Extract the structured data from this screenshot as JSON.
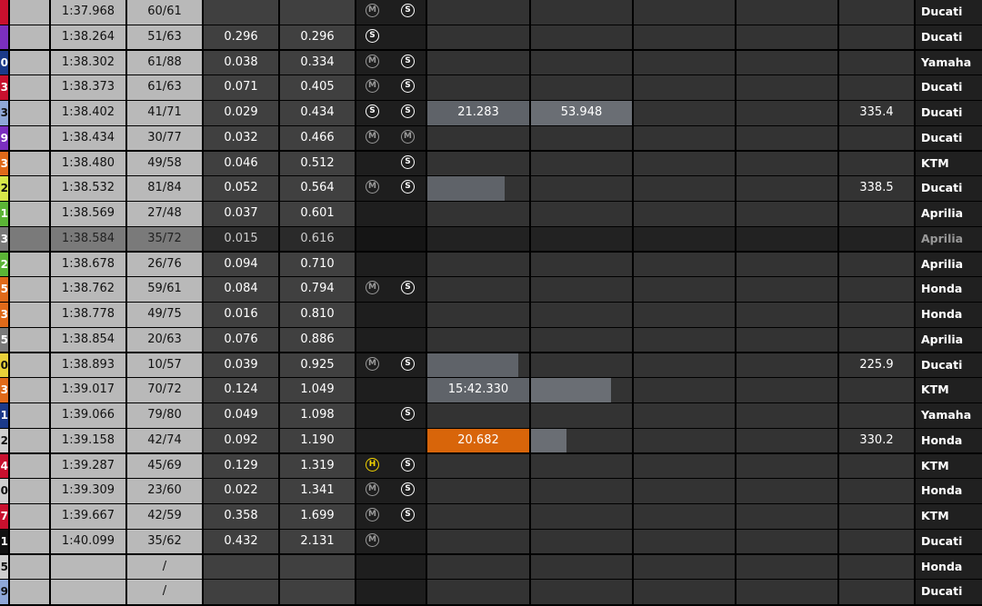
{
  "colors": {
    "sector_grey": "#5f6369",
    "sector_bar_grey": "#6a6e74",
    "sector_orange": "#d8650a",
    "soft": "#ffffff",
    "medium": "#9a9a9a",
    "hard": "#f2d400"
  },
  "tyre_letters": {
    "soft": "S",
    "medium": "M",
    "hard": "H"
  },
  "rows": [
    {
      "num": "",
      "num_color": "#c8102e",
      "best_lap": "1:37.968",
      "laps": "60/61",
      "gap": "",
      "to_leader": "",
      "tyres": [
        "medium",
        "soft"
      ],
      "s1": "",
      "s1_fill": 0,
      "s1_color": "",
      "s2": "",
      "s2_fill": 0,
      "speed": "",
      "manufacturer": "Ducati"
    },
    {
      "num": "",
      "num_color": "#7b2fbf",
      "best_lap": "1:38.264",
      "laps": "51/63",
      "gap": "0.296",
      "to_leader": "0.296",
      "tyres": [
        "soft"
      ],
      "s1": "",
      "s1_fill": 0,
      "s1_color": "",
      "s2": "",
      "s2_fill": 0,
      "speed": "",
      "manufacturer": "Ducati"
    },
    {
      "num": "0",
      "num_color": "#1b3a8a",
      "best_lap": "1:38.302",
      "laps": "61/88",
      "gap": "0.038",
      "to_leader": "0.334",
      "tyres": [
        "medium",
        "soft"
      ],
      "s1": "",
      "s1_fill": 0,
      "s1_color": "",
      "s2": "",
      "s2_fill": 0,
      "speed": "",
      "manufacturer": "Yamaha"
    },
    {
      "num": "3",
      "num_color": "#c8102e",
      "best_lap": "1:38.373",
      "laps": "61/63",
      "gap": "0.071",
      "to_leader": "0.405",
      "tyres": [
        "medium",
        "soft"
      ],
      "s1": "",
      "s1_fill": 0,
      "s1_color": "",
      "s2": "",
      "s2_fill": 0,
      "speed": "",
      "manufacturer": "Ducati"
    },
    {
      "num": "3",
      "num_color": "#8fa8d8",
      "best_lap": "1:38.402",
      "laps": "41/71",
      "gap": "0.029",
      "to_leader": "0.434",
      "tyres": [
        "soft",
        "soft"
      ],
      "s1": "21.283",
      "s1_fill": 1,
      "s1_color": "grey",
      "s2": "53.948",
      "s2_fill": 1,
      "speed": "335.4",
      "manufacturer": "Ducati"
    },
    {
      "num": "9",
      "num_color": "#7b2fbf",
      "best_lap": "1:38.434",
      "laps": "30/77",
      "gap": "0.032",
      "to_leader": "0.466",
      "tyres": [
        "medium",
        "medium"
      ],
      "s1": "",
      "s1_fill": 0,
      "s1_color": "",
      "s2": "",
      "s2_fill": 0,
      "speed": "",
      "manufacturer": "Ducati"
    },
    {
      "num": "3",
      "num_color": "#e06a1a",
      "best_lap": "1:38.480",
      "laps": "49/58",
      "gap": "0.046",
      "to_leader": "0.512",
      "tyres": [
        "",
        "soft"
      ],
      "s1": "",
      "s1_fill": 0,
      "s1_color": "",
      "s2": "",
      "s2_fill": 0,
      "speed": "",
      "manufacturer": "KTM"
    },
    {
      "num": "2",
      "num_color": "#d8e84a",
      "best_lap": "1:38.532",
      "laps": "81/84",
      "gap": "0.052",
      "to_leader": "0.564",
      "tyres": [
        "medium",
        "soft"
      ],
      "s1": "",
      "s1_fill": 0.76,
      "s1_color": "grey",
      "s2": "",
      "s2_fill": 0,
      "speed": "338.5",
      "manufacturer": "Ducati"
    },
    {
      "num": "1",
      "num_color": "#5bb536",
      "best_lap": "1:38.569",
      "laps": "27/48",
      "gap": "0.037",
      "to_leader": "0.601",
      "tyres": [],
      "s1": "",
      "s1_fill": 0,
      "s1_color": "",
      "s2": "",
      "s2_fill": 0,
      "speed": "",
      "manufacturer": "Aprilia"
    },
    {
      "num": "3",
      "num_color": "#7a7a7a",
      "best_lap": "1:38.584",
      "laps": "35/72",
      "gap": "0.015",
      "to_leader": "0.616",
      "tyres": [],
      "s1": "",
      "s1_fill": 0,
      "s1_color": "",
      "s2": "",
      "s2_fill": 0,
      "speed": "",
      "manufacturer": "Aprilia",
      "dim": true
    },
    {
      "num": "2",
      "num_color": "#5bb536",
      "best_lap": "1:38.678",
      "laps": "26/76",
      "gap": "0.094",
      "to_leader": "0.710",
      "tyres": [],
      "s1": "",
      "s1_fill": 0,
      "s1_color": "",
      "s2": "",
      "s2_fill": 0,
      "speed": "",
      "manufacturer": "Aprilia"
    },
    {
      "num": "5",
      "num_color": "#e06a1a",
      "best_lap": "1:38.762",
      "laps": "59/61",
      "gap": "0.084",
      "to_leader": "0.794",
      "tyres": [
        "medium",
        "soft"
      ],
      "s1": "",
      "s1_fill": 0,
      "s1_color": "",
      "s2": "",
      "s2_fill": 0,
      "speed": "",
      "manufacturer": "Honda"
    },
    {
      "num": "3",
      "num_color": "#e06a1a",
      "best_lap": "1:38.778",
      "laps": "49/75",
      "gap": "0.016",
      "to_leader": "0.810",
      "tyres": [],
      "s1": "",
      "s1_fill": 0,
      "s1_color": "",
      "s2": "",
      "s2_fill": 0,
      "speed": "",
      "manufacturer": "Honda"
    },
    {
      "num": "5",
      "num_color": "#7a7a7a",
      "best_lap": "1:38.854",
      "laps": "20/63",
      "gap": "0.076",
      "to_leader": "0.886",
      "tyres": [],
      "s1": "",
      "s1_fill": 0,
      "s1_color": "",
      "s2": "",
      "s2_fill": 0,
      "speed": "",
      "manufacturer": "Aprilia"
    },
    {
      "num": "0",
      "num_color": "#e8d13a",
      "best_lap": "1:38.893",
      "laps": "10/57",
      "gap": "0.039",
      "to_leader": "0.925",
      "tyres": [
        "medium",
        "soft"
      ],
      "s1": "",
      "s1_fill": 0.89,
      "s1_color": "grey",
      "s2": "",
      "s2_fill": 0,
      "speed": "225.9",
      "manufacturer": "Ducati"
    },
    {
      "num": "3",
      "num_color": "#e06a1a",
      "best_lap": "1:39.017",
      "laps": "70/72",
      "gap": "0.124",
      "to_leader": "1.049",
      "tyres": [],
      "s1": "15:42.330",
      "s1_fill": 1,
      "s1_color": "grey",
      "s2": "",
      "s2_fill": 0.79,
      "speed": "",
      "manufacturer": "KTM"
    },
    {
      "num": "1",
      "num_color": "#1b3a8a",
      "best_lap": "1:39.066",
      "laps": "79/80",
      "gap": "0.049",
      "to_leader": "1.098",
      "tyres": [
        "",
        "soft"
      ],
      "s1": "",
      "s1_fill": 0,
      "s1_color": "",
      "s2": "",
      "s2_fill": 0,
      "speed": "",
      "manufacturer": "Yamaha"
    },
    {
      "num": "2",
      "num_color": "#cfcfcf",
      "best_lap": "1:39.158",
      "laps": "42/74",
      "gap": "0.092",
      "to_leader": "1.190",
      "tyres": [],
      "s1": "20.682",
      "s1_fill": 1,
      "s1_color": "orange",
      "s2": "",
      "s2_fill": 0.35,
      "speed": "330.2",
      "manufacturer": "Honda"
    },
    {
      "num": "4",
      "num_color": "#c8102e",
      "best_lap": "1:39.287",
      "laps": "45/69",
      "gap": "0.129",
      "to_leader": "1.319",
      "tyres": [
        "hard",
        "soft"
      ],
      "s1": "",
      "s1_fill": 0,
      "s1_color": "",
      "s2": "",
      "s2_fill": 0,
      "speed": "",
      "manufacturer": "KTM"
    },
    {
      "num": "0",
      "num_color": "#cfcfcf",
      "best_lap": "1:39.309",
      "laps": "23/60",
      "gap": "0.022",
      "to_leader": "1.341",
      "tyres": [
        "medium",
        "soft"
      ],
      "s1": "",
      "s1_fill": 0,
      "s1_color": "",
      "s2": "",
      "s2_fill": 0,
      "speed": "",
      "manufacturer": "Honda"
    },
    {
      "num": "7",
      "num_color": "#c8102e",
      "best_lap": "1:39.667",
      "laps": "42/59",
      "gap": "0.358",
      "to_leader": "1.699",
      "tyres": [
        "medium",
        "soft"
      ],
      "s1": "",
      "s1_fill": 0,
      "s1_color": "",
      "s2": "",
      "s2_fill": 0,
      "speed": "",
      "manufacturer": "KTM"
    },
    {
      "num": "1",
      "num_color": "#111111",
      "best_lap": "1:40.099",
      "laps": "35/62",
      "gap": "0.432",
      "to_leader": "2.131",
      "tyres": [
        "medium"
      ],
      "s1": "",
      "s1_fill": 0,
      "s1_color": "",
      "s2": "",
      "s2_fill": 0,
      "speed": "",
      "manufacturer": "Ducati"
    },
    {
      "num": "5",
      "num_color": "#cfcfcf",
      "best_lap": "",
      "laps": "/",
      "gap": "",
      "to_leader": "",
      "tyres": [],
      "s1": "",
      "s1_fill": 0,
      "s1_color": "",
      "s2": "",
      "s2_fill": 0,
      "speed": "",
      "manufacturer": "Honda"
    },
    {
      "num": "9",
      "num_color": "#8fa8d8",
      "best_lap": "",
      "laps": "/",
      "gap": "",
      "to_leader": "",
      "tyres": [],
      "s1": "",
      "s1_fill": 0,
      "s1_color": "",
      "s2": "",
      "s2_fill": 0,
      "speed": "",
      "manufacturer": "Ducati"
    }
  ]
}
